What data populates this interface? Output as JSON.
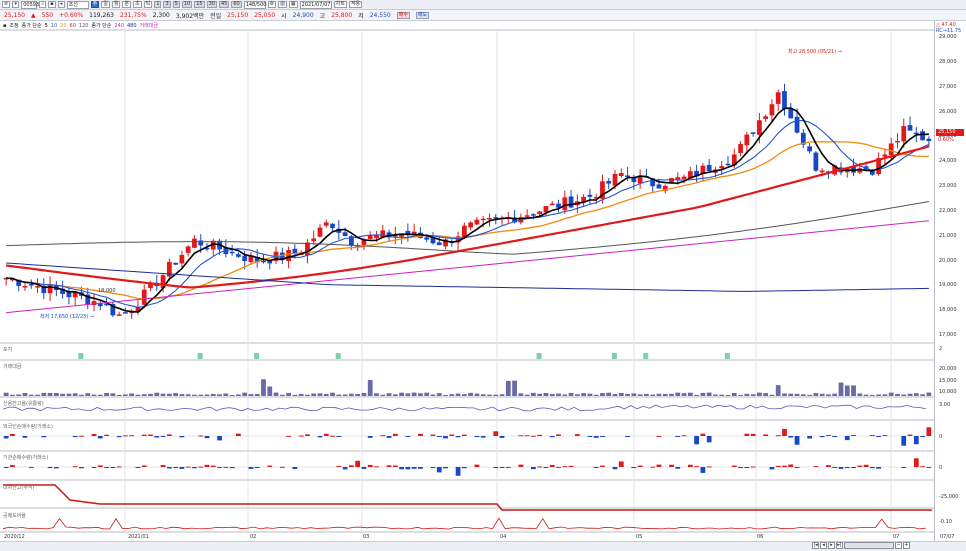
{
  "toolbar1": {
    "stock_code": "005930",
    "stock_name": "조선",
    "buttons": [
      "주",
      "일",
      "월",
      "분",
      "초",
      "틱"
    ],
    "periods": [
      "1",
      "3",
      "5",
      "10",
      "15",
      "30",
      "45",
      "60"
    ],
    "count": "148/500",
    "date": "2021/07/07",
    "menu_labels": [
      "차트",
      "적용"
    ]
  },
  "toolbar2": {
    "price": "25,150",
    "arrow": "▲",
    "change": "550",
    "change_pct": "+0.60%",
    "volume": "119,263",
    "vol_pct": "231.75%",
    "amount": "2,300",
    "amount2": "3,902백만",
    "prev_label": "전일",
    "prev": "25,150",
    "prev2": "25,050",
    "open_label": "시",
    "open": "24,900",
    "high_label": "고",
    "high": "25,800",
    "low_label": "저",
    "low": "24,550",
    "buy_btn": "매수",
    "sell_btn": "매도"
  },
  "legend": {
    "strip_text": "조정",
    "ma_label": "종가 단순",
    "ma_values": [
      "5",
      "10",
      "20",
      "60",
      "120"
    ],
    "ma2_label": "종가 단순",
    "ma2_values": [
      "240",
      "480"
    ],
    "ma2_extra": "거래대금"
  },
  "annotations": {
    "high": "최고 28,500 (05/21) →",
    "low": "최저 17,650 (12/23) →",
    "top_right1": "△ 47.40",
    "top_right2": "RC→11.75",
    "price_tag": "25,150",
    "price_pct": "0.60%",
    "mid_tag": "18,000"
  },
  "panels": [
    {
      "label": "포지",
      "ticks": [
        "2"
      ]
    },
    {
      "label": "거래대금",
      "ticks": [
        "20,000",
        "15,000",
        "10,000"
      ]
    },
    {
      "label": "신용잔고율(유통량)",
      "ticks": [
        "3.00"
      ]
    },
    {
      "label": "외국인순매수량(거래소)",
      "ticks": [
        "0"
      ]
    },
    {
      "label": "기관순매수량(거래소)",
      "ticks": [
        "0"
      ]
    },
    {
      "label": "대차잔고(주식)",
      "ticks": [
        "-25,000"
      ]
    },
    {
      "label": "공매도비율",
      "ticks": [
        "-0.10"
      ]
    }
  ],
  "y_axis": [
    "29,000",
    "28,000",
    "27,000",
    "26,000",
    "25,000",
    "24,000",
    "23,000",
    "22,000",
    "21,000",
    "20,000",
    "19,000",
    "18,000",
    "17,000"
  ],
  "x_axis": [
    "2020/12",
    "2021/01",
    "02",
    "03",
    "04",
    "05",
    "06",
    "07",
    "07/07"
  ],
  "colors": {
    "up": "#e0191b",
    "down": "#1848c8",
    "ma5": "#000000",
    "ma10": "#2255d4",
    "ma20": "#f08a10",
    "ma60": "#e0191b",
    "ma120": "#555555",
    "ma240": "#d020c0",
    "ma480": "#1c2b9c"
  }
}
